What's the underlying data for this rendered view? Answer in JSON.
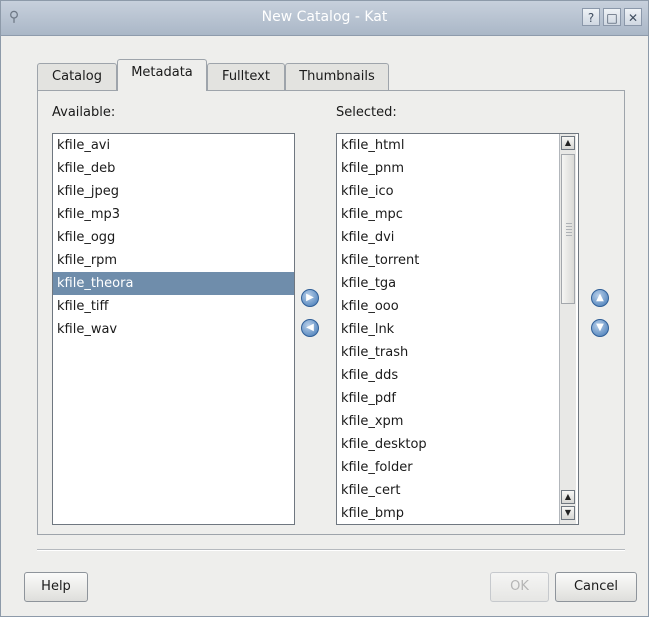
{
  "window": {
    "title": "New Catalog - Kat",
    "controls": {
      "help": "?",
      "maximize": "□",
      "close": "✕"
    }
  },
  "tabs": [
    {
      "label": "Catalog",
      "active": false
    },
    {
      "label": "Metadata",
      "active": true
    },
    {
      "label": "Fulltext",
      "active": false
    },
    {
      "label": "Thumbnails",
      "active": false
    }
  ],
  "available": {
    "label": "Available:",
    "items": [
      "kfile_avi",
      "kfile_deb",
      "kfile_jpeg",
      "kfile_mp3",
      "kfile_ogg",
      "kfile_rpm",
      "kfile_theora",
      "kfile_tiff",
      "kfile_wav"
    ],
    "selected_item": "kfile_theora"
  },
  "selected": {
    "label": "Selected:",
    "items": [
      "kfile_html",
      "kfile_pnm",
      "kfile_ico",
      "kfile_mpc",
      "kfile_dvi",
      "kfile_torrent",
      "kfile_tga",
      "kfile_ooo",
      "kfile_lnk",
      "kfile_trash",
      "kfile_dds",
      "kfile_pdf",
      "kfile_xpm",
      "kfile_desktop",
      "kfile_folder",
      "kfile_cert",
      "kfile_bmp"
    ]
  },
  "move_buttons": {
    "add_icon": "arrow-right-icon",
    "remove_icon": "arrow-left-icon",
    "up_icon": "arrow-up-icon",
    "down_icon": "arrow-down-icon"
  },
  "buttons": {
    "help": "Help",
    "ok": "OK",
    "cancel": "Cancel"
  },
  "colors": {
    "selection": "#6f8dab",
    "titlebar": "#aab7c7",
    "accent": "#3f76b4"
  }
}
